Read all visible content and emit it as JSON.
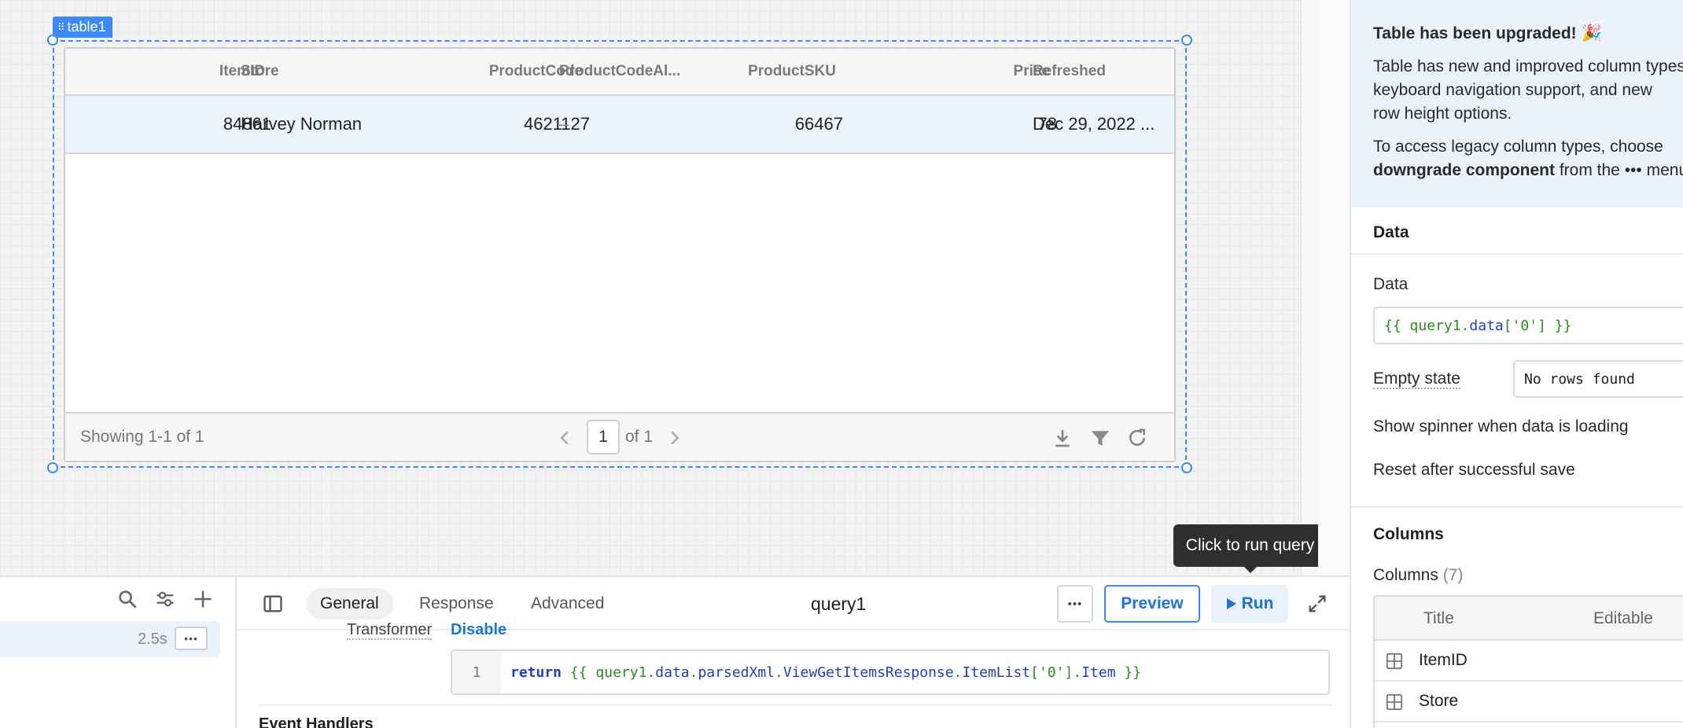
{
  "canvas": {
    "component_tag": "table1"
  },
  "table": {
    "columns": [
      {
        "label": "ItemID"
      },
      {
        "label": "Store"
      },
      {
        "label": "ProductCode"
      },
      {
        "label": "ProductCodeAl..."
      },
      {
        "label": "ProductSKU"
      },
      {
        "label": "Price"
      },
      {
        "label": "Refreshed"
      }
    ],
    "rows": [
      [
        "84861",
        "Harvey Norman",
        "4621127",
        "–",
        "66467",
        "78",
        "Dec 29, 2022 ..."
      ]
    ],
    "footer": {
      "showing": "Showing 1-1 of 1",
      "page": "1",
      "of_pages": "of 1",
      "prev_icon": "chevron-left-icon",
      "next_icon": "chevron-right-icon",
      "download_icon": "download-icon",
      "filter_icon": "filter-icon",
      "refresh_icon": "refresh-icon"
    }
  },
  "tooltip": {
    "text": "Click to run query"
  },
  "query_list": {
    "item_duration": "2.5s"
  },
  "query_editor": {
    "tabs": [
      "General",
      "Response",
      "Advanced"
    ],
    "active_tab": "General",
    "title": "query1",
    "preview_label": "Preview",
    "run_label": "Run",
    "transformer_label": "Transformer",
    "disable_label": "Disable",
    "code_line_number": "1",
    "code": {
      "keyword": "return",
      "open": "{{ ",
      "ident": "query1",
      "dot1": ".",
      "prop1": "data",
      "dot2": ".",
      "prop2": "parsedXml",
      "dot3": ".",
      "prop3": "ViewGetItemsResponse",
      "dot4": ".",
      "prop4": "ItemList",
      "index": "['0']",
      "dot5": ".",
      "prop5": "Item",
      "close": " }}"
    },
    "event_handlers_label": "Event Handlers"
  },
  "inspector": {
    "banner": {
      "title": "Table has been upgraded! 🎉",
      "body_line1": "Table has new and improved column types,",
      "body_line2": "keyboard navigation support, and new",
      "body_line3": "row height options.",
      "legacy_line1": "To access legacy column types, choose",
      "legacy_bold": "downgrade component",
      "legacy_rest": " from the ••• menu."
    },
    "data_section": {
      "title": "Data",
      "data_label": "Data",
      "data_value": {
        "open": "{{ ",
        "ident": "query1",
        "dot": ".",
        "prop": "data",
        "index": "['0']",
        "close": " }}"
      },
      "empty_state_label": "Empty state",
      "empty_state_value": "No rows found",
      "spinner_label": "Show spinner when data is loading",
      "reset_label": "Reset after successful save"
    },
    "columns_section": {
      "title": "Columns",
      "columns_label": "Columns",
      "columns_count": "(7)",
      "head_title": "Title",
      "head_editable": "Editable",
      "rows": [
        "ItemID",
        "Store"
      ]
    }
  },
  "colors": {
    "accent": "#3d8af7",
    "link": "#1e73d6",
    "code_green": "#2e8b20",
    "code_blue": "#1f3fbf"
  }
}
